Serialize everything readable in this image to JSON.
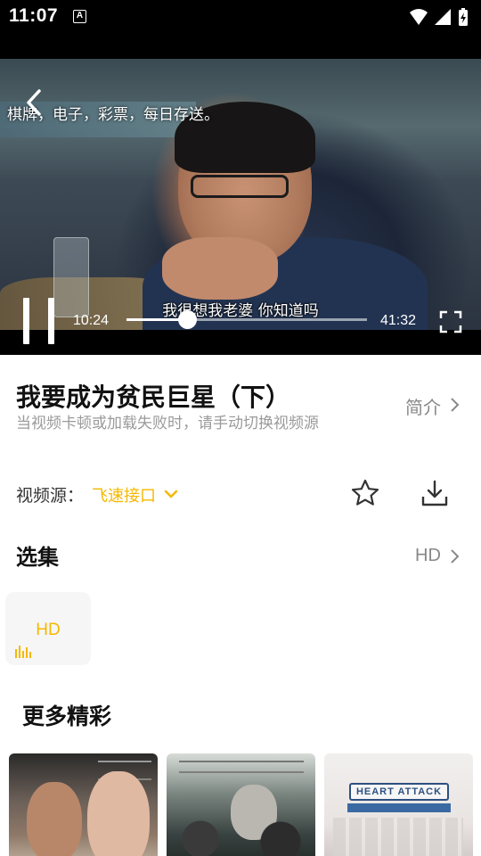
{
  "status_bar": {
    "time": "11:07",
    "notification_icon": "A"
  },
  "player": {
    "marquee_text": "棋牌，电子，彩票，每日存送。",
    "subtitle": "我很想我老婆 你知道吗",
    "current_time": "10:24",
    "total_time": "41:32",
    "progress_fraction": 0.25,
    "state": "playing"
  },
  "video": {
    "title": "我要成为贫民巨星（下）",
    "intro_label": "简介",
    "hint": "当视频卡顿或加载失败时，请手动切换视频源"
  },
  "source": {
    "label": "视频源：",
    "value": "飞速接口"
  },
  "episodes": {
    "heading": "选集",
    "quality_link": "HD",
    "items": [
      {
        "label": "HD",
        "active": true
      }
    ]
  },
  "more": {
    "heading": "更多精彩",
    "posters": [
      {
        "title_art": ""
      },
      {
        "title_art": ""
      },
      {
        "title_art": "HEART ATTACK"
      }
    ]
  },
  "colors": {
    "accent": "#f5b800",
    "muted": "#888888",
    "hint": "#9a9a9a",
    "title": "#111111"
  },
  "icons": {
    "back": "chevron-left-icon",
    "pause": "pause-icon",
    "fullscreen": "fullscreen-icon",
    "favorite": "star-icon",
    "download": "download-icon",
    "dropdown": "chevron-down-icon",
    "playing": "sound-bars-icon"
  }
}
